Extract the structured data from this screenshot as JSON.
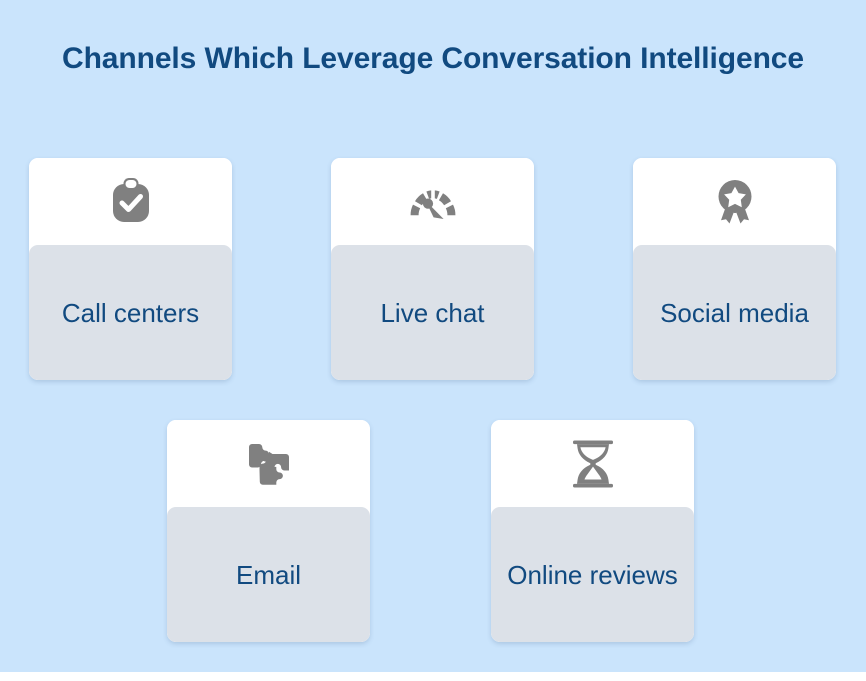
{
  "header": {
    "title": "Channels Which Leverage Conversation Intelligence"
  },
  "colors": {
    "background": "#cae4fc",
    "title_text": "#114a80",
    "card_top": "#ffffff",
    "card_label_panel": "#dce1e8",
    "card_label_text": "#114a80",
    "icon": "#808080"
  },
  "cards": [
    {
      "label": "Call centers",
      "icon": "clipboard-check-icon"
    },
    {
      "label": "Live chat",
      "icon": "speedometer-icon"
    },
    {
      "label": "Social media",
      "icon": "award-star-icon"
    },
    {
      "label": "Email",
      "icon": "puzzle-pieces-icon"
    },
    {
      "label": "Online reviews",
      "icon": "hourglass-icon"
    }
  ]
}
